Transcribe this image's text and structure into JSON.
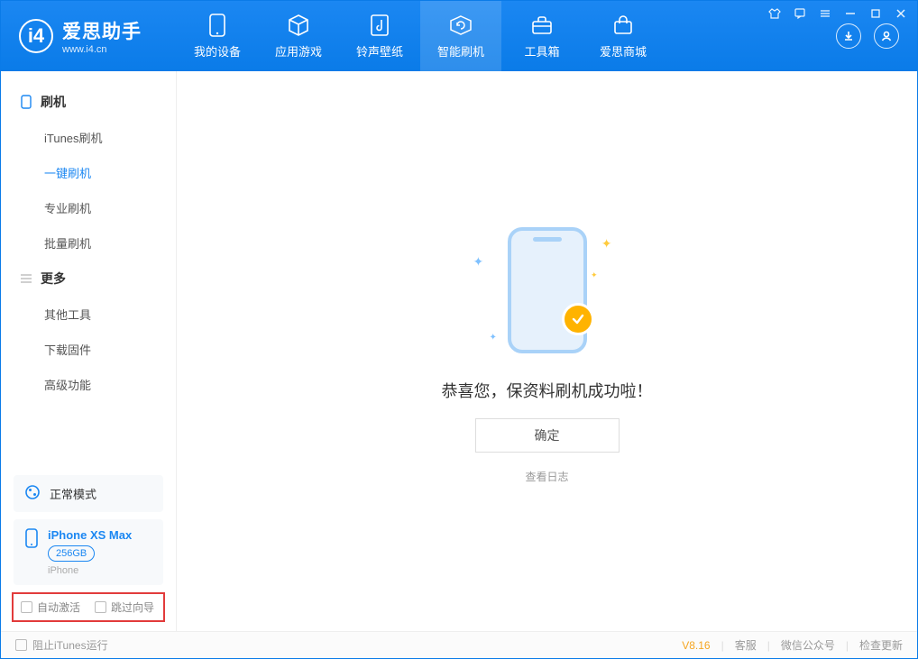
{
  "app": {
    "name_cn": "爱思助手",
    "name_en": "www.i4.cn"
  },
  "tabs": {
    "device": "我的设备",
    "apps": "应用游戏",
    "ring": "铃声壁纸",
    "flash": "智能刷机",
    "tools": "工具箱",
    "store": "爱思商城"
  },
  "sidebar": {
    "group_flash": "刷机",
    "items_flash": {
      "itunes": "iTunes刷机",
      "onekey": "一键刷机",
      "pro": "专业刷机",
      "batch": "批量刷机"
    },
    "group_more": "更多",
    "items_more": {
      "other": "其他工具",
      "firmware": "下载固件",
      "advanced": "高级功能"
    }
  },
  "status": {
    "mode": "正常模式"
  },
  "device": {
    "name": "iPhone XS Max",
    "storage": "256GB",
    "type": "iPhone"
  },
  "options": {
    "auto_activate": "自动激活",
    "skip_guide": "跳过向导"
  },
  "main": {
    "success": "恭喜您，保资料刷机成功啦！",
    "ok": "确定",
    "view_log": "查看日志"
  },
  "footer": {
    "block_itunes": "阻止iTunes运行",
    "version": "V8.16",
    "support": "客服",
    "wechat": "微信公众号",
    "update": "检查更新"
  }
}
